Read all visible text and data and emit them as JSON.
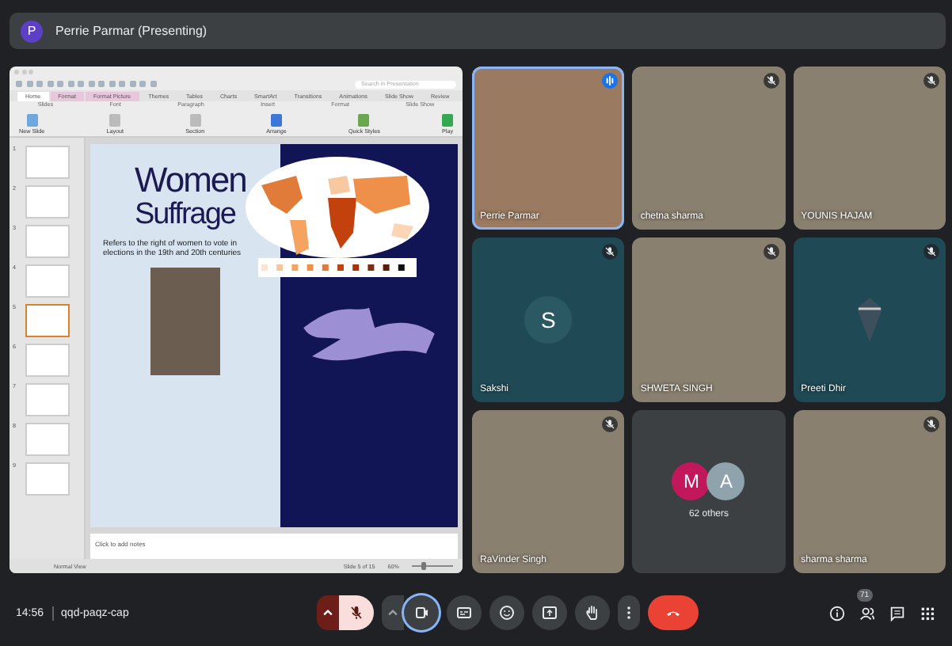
{
  "header": {
    "initial": "P",
    "title": "Perrie Parmar (Presenting)"
  },
  "presentation": {
    "search": {
      "placeholder": "Search in Presentation"
    },
    "ribbon_tabs": [
      {
        "label": "Home",
        "kind": "home"
      },
      {
        "label": "Format",
        "kind": "contextual"
      },
      {
        "label": "Format Picture",
        "kind": "contextual"
      },
      {
        "label": "Themes",
        "kind": "standard"
      },
      {
        "label": "Tables",
        "kind": "standard"
      },
      {
        "label": "Charts",
        "kind": "standard"
      },
      {
        "label": "SmartArt",
        "kind": "standard"
      },
      {
        "label": "Transitions",
        "kind": "standard"
      },
      {
        "label": "Animations",
        "kind": "standard"
      },
      {
        "label": "Slide Show",
        "kind": "standard"
      },
      {
        "label": "Review",
        "kind": "standard"
      }
    ],
    "ribbon_groups": [
      "Slides",
      "Font",
      "Paragraph",
      "Insert",
      "Format",
      "Slide Show"
    ],
    "ribbon_buttons": [
      {
        "label": "New Slide",
        "kind": "newslide"
      },
      {
        "label": "Layout",
        "kind": "layout"
      },
      {
        "label": "Section",
        "kind": "section"
      },
      {
        "label": "Arrange",
        "kind": "arrange"
      },
      {
        "label": "Quick Styles",
        "kind": "styles"
      },
      {
        "label": "Play",
        "kind": "play"
      }
    ],
    "thumbnails": [
      {
        "number": "1",
        "selected": false
      },
      {
        "number": "2",
        "selected": false
      },
      {
        "number": "3",
        "selected": false
      },
      {
        "number": "4",
        "selected": false
      },
      {
        "number": "5",
        "selected": true
      },
      {
        "number": "6",
        "selected": false
      },
      {
        "number": "7",
        "selected": false
      },
      {
        "number": "8",
        "selected": false
      },
      {
        "number": "9",
        "selected": false
      }
    ],
    "slide": {
      "title": [
        "Women",
        "Suffrage"
      ],
      "body": "Refers to the right of women to vote in elections in the 19th and 20th centuries"
    },
    "notes": {
      "placeholder": "Click to add notes"
    },
    "status_bar": {
      "view": "Normal View",
      "slide": "Slide 5 of 15",
      "zoom": "60%",
      "zoom_level": {
        "level": 0.3
      }
    }
  },
  "tiles": [
    {
      "name": "Perrie Parmar",
      "kind": "video",
      "muted": false,
      "speaking": true
    },
    {
      "name": "chetna sharma",
      "kind": "video",
      "muted": true,
      "speaking": false
    },
    {
      "name": "YOUNIS HAJAM",
      "kind": "video",
      "muted": true,
      "speaking": false
    },
    {
      "name": "Sakshi",
      "kind": "avatar",
      "initial": "S",
      "muted": true,
      "speaking": false
    },
    {
      "name": "SHWETA SINGH",
      "kind": "video",
      "muted": true,
      "speaking": false
    },
    {
      "name": "Preeti Dhir",
      "kind": "logo",
      "muted": true,
      "speaking": false
    },
    {
      "name": "RaVinder Singh",
      "kind": "video",
      "muted": true,
      "speaking": false
    },
    {
      "name": "62 others",
      "kind": "others",
      "avatars": [
        {
          "initial": "M",
          "color": "#c2185b"
        },
        {
          "initial": "A",
          "color": "#8fa3ad"
        }
      ]
    },
    {
      "name": "sharma sharma",
      "kind": "video",
      "muted": true,
      "speaking": false
    }
  ],
  "toolbar": {
    "time": "14:56",
    "code": "qqd-paqz-cap",
    "controls": [
      {
        "kind": "mic-options"
      },
      {
        "kind": "mic",
        "muted": true
      },
      {
        "kind": "camera-options"
      },
      {
        "kind": "camera",
        "focused": true
      },
      {
        "kind": "captions"
      },
      {
        "kind": "emoji"
      },
      {
        "kind": "present"
      },
      {
        "kind": "hand"
      },
      {
        "kind": "more"
      },
      {
        "kind": "end"
      }
    ],
    "people_count": "71"
  }
}
